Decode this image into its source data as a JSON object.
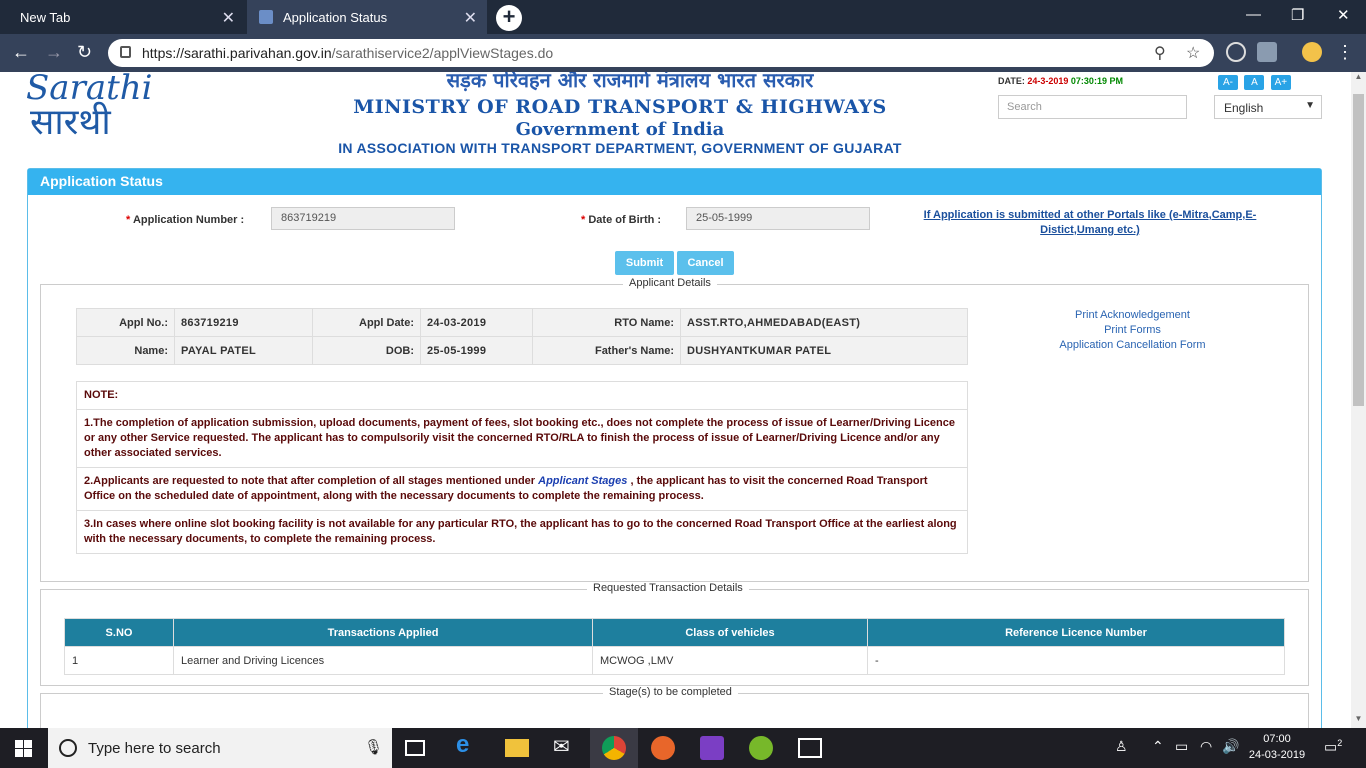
{
  "browser": {
    "tabs": [
      {
        "title": "New Tab"
      },
      {
        "title": "Application Status"
      }
    ],
    "url_host": "https://sarathi.parivahan.gov.in",
    "url_path": "/sarathiservice2/applViewStages.do"
  },
  "header": {
    "logo_top": "Sarathi",
    "logo_bottom": "सारथी",
    "hindi_title": "सड़क परिवहन और राजमार्ग मंत्रालय भारत सरकार",
    "ministry": "MINISTRY OF ROAD TRANSPORT & HIGHWAYS",
    "government": "Government of India",
    "association": "IN ASSOCIATION WITH TRANSPORT DEPARTMENT, GOVERNMENT OF GUJARAT",
    "date_label": "DATE:",
    "date_value": "24-3-2019",
    "time_value": "07:30:19 PM",
    "font_buttons": [
      "A-",
      "A",
      "A+"
    ],
    "search_placeholder": "Search",
    "language": "English"
  },
  "panel": {
    "title": "Application Status",
    "app_number_label": "Application Number :",
    "app_number_value": "863719219",
    "dob_label": "Date of Birth :",
    "dob_value": "25-05-1999",
    "portal_link": "If Application is submitted at other Portals like (e-Mitra,Camp,E-Distict,Umang etc.)",
    "submit_label": "Submit",
    "cancel_label": "Cancel"
  },
  "applicant": {
    "legend": "Applicant Details",
    "appl_no_label": "Appl No.:",
    "appl_no": "863719219",
    "appl_date_label": "Appl Date:",
    "appl_date": "24-03-2019",
    "rto_label": "RTO Name:",
    "rto": "ASST.RTO,AHMEDABAD(EAST)",
    "name_label": "Name:",
    "name": "PAYAL PATEL",
    "dob_label": "DOB:",
    "dob": "25-05-1999",
    "father_label": "Father's Name:",
    "father": "DUSHYANTKUMAR PATEL",
    "links": [
      "Print Acknowledgement",
      "Print Forms",
      "Application Cancellation Form"
    ]
  },
  "note": {
    "title": "NOTE:",
    "p1": "1.The completion of application submission, upload documents, payment of fees, slot booking etc., does not complete the process of issue of Learner/Driving Licence or any other Service requested. The applicant has to compulsorily visit the concerned RTO/RLA to finish the process of issue of Learner/Driving Licence and/or any other associated services.",
    "p2_pre": "2.Applicants are requested to note that after completion of all stages mentioned under",
    "p2_link": "Applicant Stages",
    "p2_post": ", the applicant has to visit the concerned Road Transport Office on the scheduled date of appointment, along with the necessary documents to complete the remaining process.",
    "p3": "3.In cases where online slot booking facility is not available for any particular RTO, the applicant has to go to the concerned Road Transport Office at the earliest along with the necessary documents, to complete the remaining process."
  },
  "transactions": {
    "legend": "Requested Transaction Details",
    "headers": [
      "S.NO",
      "Transactions Applied",
      "Class of vehicles",
      "Reference Licence Number"
    ],
    "rows": [
      [
        "1",
        "Learner and Driving Licences",
        "MCWOG ,LMV",
        "-"
      ]
    ]
  },
  "stages": {
    "legend": "Stage(s) to be completed"
  },
  "taskbar": {
    "search_text": "Type here to search",
    "time": "07:00",
    "date": "24-03-2019",
    "notifications": "2"
  }
}
